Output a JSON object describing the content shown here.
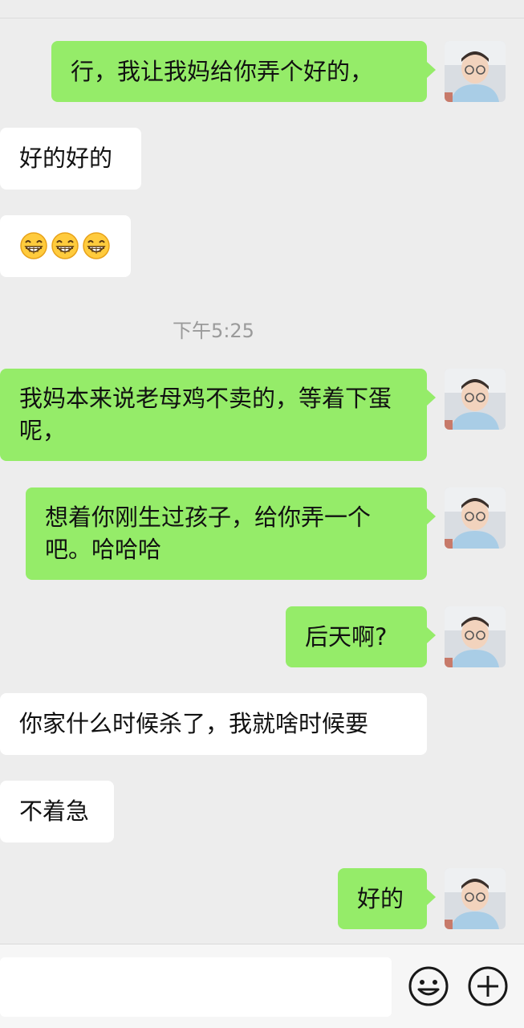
{
  "messages": [
    {
      "side": "mine",
      "text": "行，我让我妈给你弄个好的，"
    },
    {
      "side": "theirs",
      "text": "好的好的"
    },
    {
      "side": "theirs",
      "emoji": [
        "grinning-face-emoji",
        "grinning-face-emoji",
        "grinning-face-emoji"
      ]
    },
    {
      "side": "mine",
      "text": "我妈本来说老母鸡不卖的，等着下蛋呢，"
    },
    {
      "side": "mine",
      "text": "想着你刚生过孩子，给你弄一个吧。哈哈哈"
    },
    {
      "side": "mine",
      "text": "后天啊?"
    },
    {
      "side": "theirs",
      "text": "你家什么时候杀了，我就啥时候要"
    },
    {
      "side": "theirs",
      "text": "不着急"
    },
    {
      "side": "mine",
      "text": "好的"
    }
  ],
  "timestamp": "下午5:25",
  "input_bar": {
    "value": "",
    "emoji_button_icon": "smiley-face-icon",
    "more_button_icon": "plus-circle-icon"
  },
  "colors": {
    "background": "#ededed",
    "mine_bubble": "#95ec69",
    "theirs_bubble": "#ffffff",
    "timestamp_text": "#9a9a9a"
  }
}
